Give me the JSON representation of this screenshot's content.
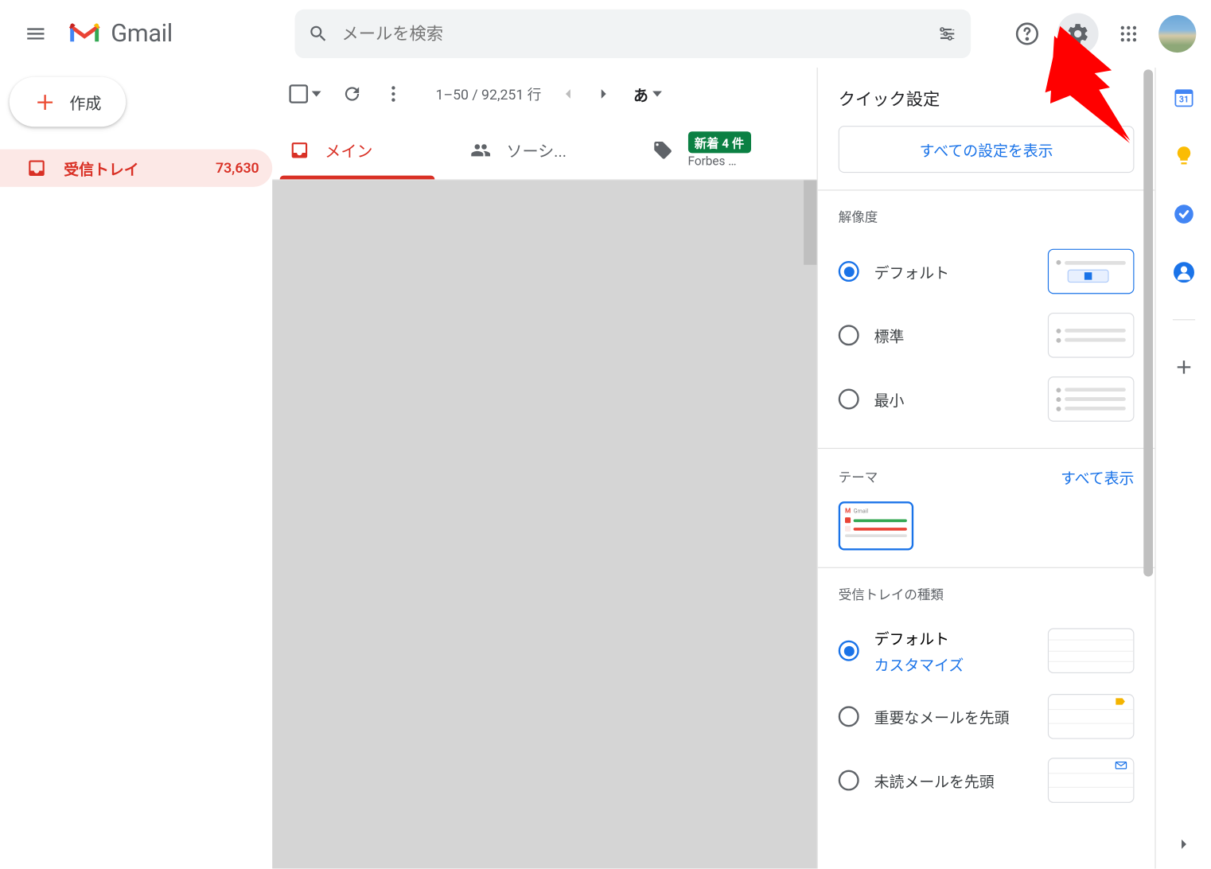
{
  "header": {
    "app_name": "Gmail",
    "search_placeholder": "メールを検索"
  },
  "sidebar": {
    "compose_label": "作成",
    "inbox_label": "受信トレイ",
    "inbox_count": "73,630"
  },
  "toolbar": {
    "pager_text": "1–50 / 92,251 行",
    "lang_symbol": "あ"
  },
  "tabs": {
    "primary": "メイン",
    "social": "ソーシ...",
    "promo_badge": "新着 4 件",
    "promo_sub": "Forbes …"
  },
  "quick_settings": {
    "title": "クイック設定",
    "all_settings": "すべての設定を表示",
    "density": {
      "section": "解像度",
      "default": "デフォルト",
      "standard": "標準",
      "compact": "最小"
    },
    "theme": {
      "section": "テーマ",
      "view_all": "すべて表示"
    },
    "inbox_type": {
      "section": "受信トレイの種類",
      "default": "デフォルト",
      "customize": "カスタマイズ",
      "important_first": "重要なメールを先頭",
      "unread_first": "未読メールを先頭"
    }
  }
}
